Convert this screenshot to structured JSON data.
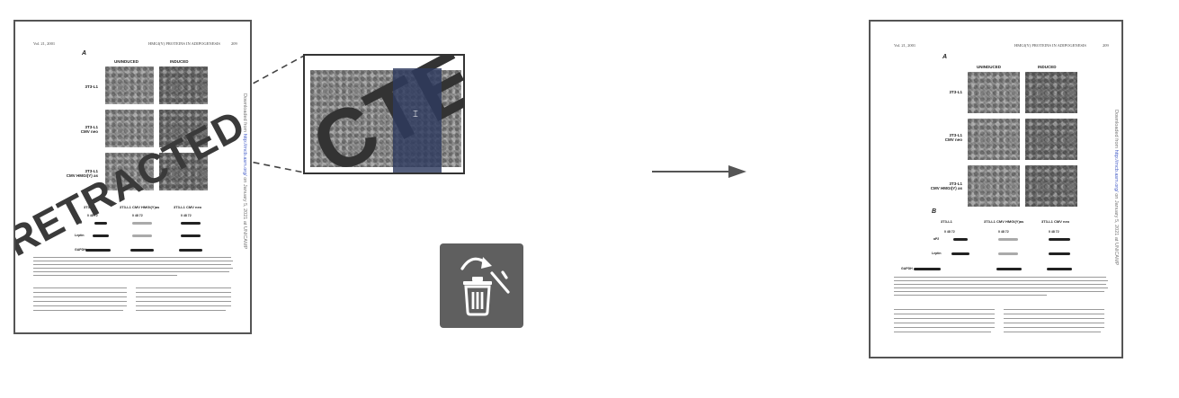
{
  "header": {
    "left": "Vol. 21, 2001",
    "center": "HMGI(Y) PROTEINS IN ADIPOGENESIS",
    "page": "209"
  },
  "figure": {
    "panel_a": "A",
    "panel_b": "B",
    "columns": [
      "UNINDUCED",
      "INDUCED"
    ],
    "rows": [
      "3T3-L1",
      "3T3-L1\nCMV neo",
      "3T3-L1\nCMV HMGI(Y) as"
    ],
    "blot_columns": [
      "3T3-L1",
      "3T3-L1 CMV HMGI(Y)as",
      "3T3-L1 CMV neo"
    ],
    "blot_ticks": "0  48  72",
    "blot_rows": [
      "aP2",
      "Leptin",
      "GAPDH"
    ]
  },
  "sidebar_text": {
    "prefix": "Downloaded from ",
    "link": "http://mcb.asm.org/",
    "suffix": " on January 5, 2021 at UNICAMP"
  },
  "watermark": "RETRACTED",
  "zoom_watermark": "CTED",
  "icons": {
    "delete": "trash-with-arrow-icon",
    "transform": "right-arrow-icon"
  },
  "colors": {
    "overlay": "#2e3a5f",
    "trash_bg": "#5f5f5f",
    "link": "#4a62c9"
  }
}
